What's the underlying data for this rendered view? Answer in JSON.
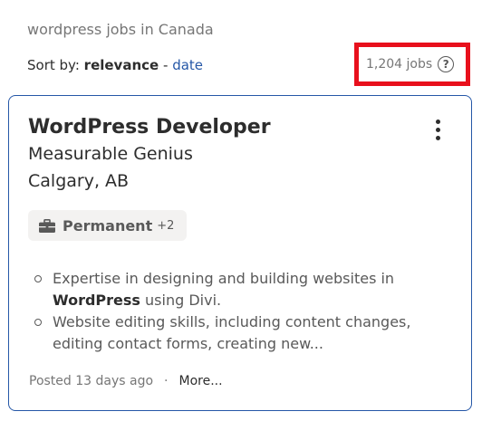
{
  "search": {
    "title": "wordpress jobs in Canada"
  },
  "sort": {
    "label": "Sort by:",
    "active": "relevance",
    "separator": "-",
    "alternative": "date"
  },
  "results": {
    "count_text": "1,204 jobs",
    "help_glyph": "?",
    "highlight_color": "#e8101c"
  },
  "job": {
    "title": "WordPress Developer",
    "company": "Measurable Genius",
    "location": "Calgary, AB",
    "tag": {
      "icon": "briefcase-icon",
      "label": "Permanent",
      "extra": "+2"
    },
    "snippet": [
      {
        "before": "Expertise in designing and building websites in ",
        "bold": "WordPress",
        "after": " using Divi."
      },
      {
        "before": "Website editing skills, including content changes, editing contact forms, creating new...",
        "bold": "",
        "after": ""
      }
    ],
    "posted": "Posted 13 days ago",
    "footer_separator": "·",
    "more_label": "More..."
  },
  "colors": {
    "link": "#2557a7",
    "card_border": "#2557a7",
    "text": "#2d2d2d",
    "muted": "#767676",
    "tag_bg": "#f3f2f1"
  }
}
